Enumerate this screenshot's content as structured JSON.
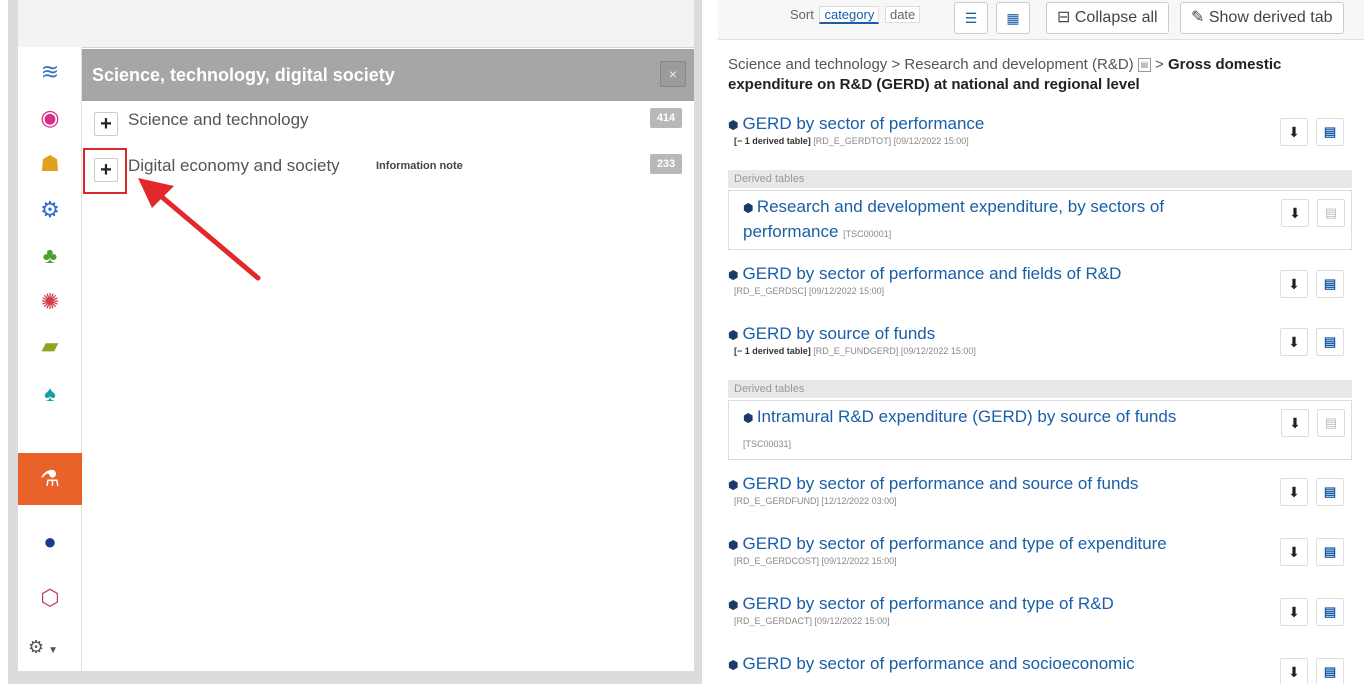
{
  "sort": {
    "label": "Sort",
    "options": [
      "category",
      "date"
    ],
    "selected": "category"
  },
  "toolbar": {
    "collapse_all": "Collapse all",
    "show_derived": "Show derived tab"
  },
  "theme": {
    "title": "Science, technology, digital society",
    "close_glyph": "×"
  },
  "icons": [
    "dataset-icon",
    "economy-icon",
    "population-icon",
    "industry-icon",
    "agriculture-icon",
    "trade-icon",
    "transport-icon",
    "environment-icon",
    "science-icon",
    "eu-icon",
    "network-icon",
    "settings-icon"
  ],
  "tree": [
    {
      "label": "Science and technology",
      "count": "414"
    },
    {
      "label": "Digital economy and society",
      "note": "Information note",
      "count": "233"
    }
  ],
  "breadcrumb": {
    "part1": "Science and technology",
    "sep": ">",
    "part2": "Research and development (R&D)",
    "current": "Gross domestic expenditure on R&D (GERD) at national and regional level"
  },
  "datasets": [
    {
      "title": "GERD by sector of performance",
      "derived": "[− 1 derived table]",
      "code": "[RD_E_GERDTOT]",
      "date": "[09/12/2022 15:00]"
    },
    {
      "title": "GERD by sector of performance and fields of R&D",
      "code": "[RD_E_GERDSC]",
      "date": "[09/12/2022 15:00]"
    },
    {
      "title": "GERD by source of funds",
      "derived": "[− 1 derived table]",
      "code": "[RD_E_FUNDGERD]",
      "date": "[09/12/2022 15:00]"
    },
    {
      "title": "GERD by sector of performance and source of funds",
      "code": "[RD_E_GERDFUND]",
      "date": "[12/12/2022 03:00]"
    },
    {
      "title": "GERD by sector of performance and type of expenditure",
      "code": "[RD_E_GERDCOST]",
      "date": "[09/12/2022 15:00]"
    },
    {
      "title": "GERD by sector of performance and type of R&D",
      "code": "[RD_E_GERDACT]",
      "date": "[09/12/2022 15:00]"
    },
    {
      "title": "GERD by sector of performance and socioeconomic",
      "code": "",
      "date": ""
    }
  ],
  "derived_tables": {
    "header": "Derived tables",
    "items": [
      {
        "title": "Research and development expenditure, by sectors of performance",
        "code": "[TSC00001]"
      },
      {
        "title": "Intramural R&D expenditure (GERD) by source of funds",
        "code": "[TSC00031]"
      }
    ]
  }
}
